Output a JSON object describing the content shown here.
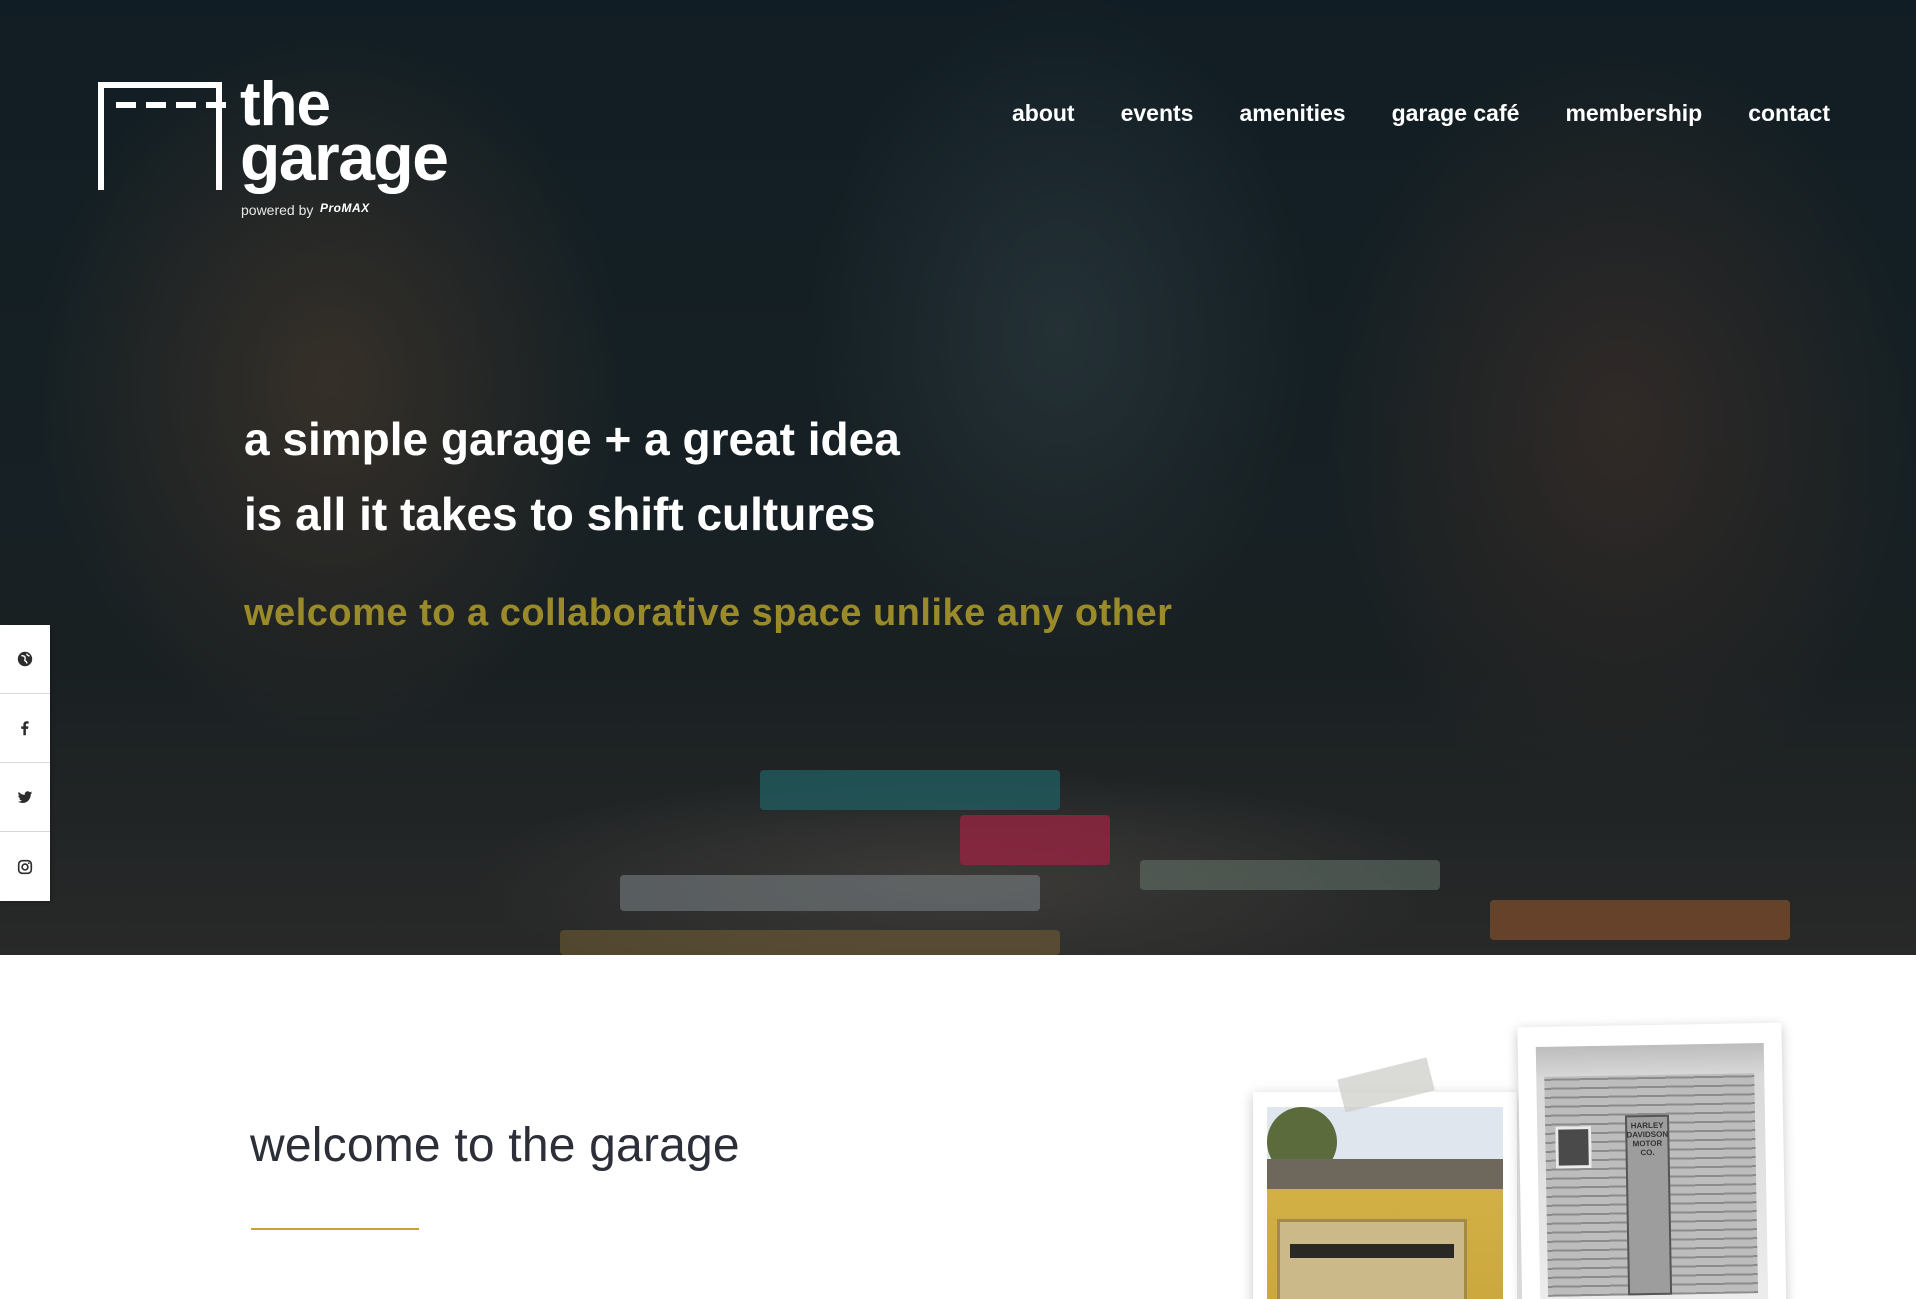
{
  "header": {
    "logo": {
      "line1": "the",
      "line2": "garage",
      "powered_by": "powered by",
      "brand": "ProMAX"
    },
    "nav": [
      {
        "label": "about"
      },
      {
        "label": "events"
      },
      {
        "label": "amenities"
      },
      {
        "label": "garage café"
      },
      {
        "label": "membership"
      },
      {
        "label": "contact"
      }
    ]
  },
  "hero": {
    "headline_line1": "a simple garage + a great idea",
    "headline_line2": "is all it takes to shift cultures",
    "tagline": "welcome to a collaborative space unlike any other"
  },
  "social": {
    "icons": [
      "globe-icon",
      "facebook-icon",
      "twitter-icon",
      "instagram-icon"
    ]
  },
  "welcome": {
    "title": "welcome to the garage"
  },
  "photos": {
    "shed_sign": [
      "HARLEY",
      "DAVIDSON",
      "MOTOR",
      "CO."
    ]
  },
  "colors": {
    "tagline": "#9a8a2a",
    "rule": "#c9a13a",
    "title": "#2c2f38",
    "nav": "#ffffff"
  }
}
